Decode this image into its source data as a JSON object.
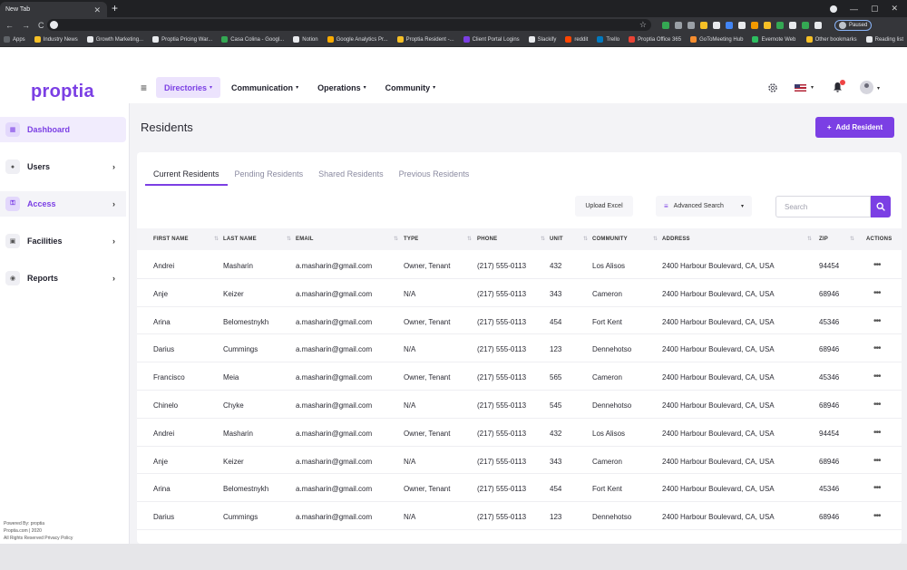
{
  "browser": {
    "tab_title": "New Tab",
    "tab_close": "✕",
    "new_tab": "+",
    "nav": [
      "←",
      "→",
      "C"
    ],
    "star": "☆",
    "paused_label": "Paused",
    "bookmarks": [
      {
        "label": "Apps",
        "color": "#5f6368"
      },
      {
        "label": "Industry News",
        "color": "#f6c026"
      },
      {
        "label": "Growth Marketing...",
        "color": "#e8eaed"
      },
      {
        "label": "Proptia Pricing War...",
        "color": "#e8eaed"
      },
      {
        "label": "Casa Colina - Googl...",
        "color": "#34a853"
      },
      {
        "label": "Notion",
        "color": "#e8eaed"
      },
      {
        "label": "Google Analytics Pr...",
        "color": "#f9ab00"
      },
      {
        "label": "Proptia Resident -...",
        "color": "#f6c026"
      },
      {
        "label": "Client Portal Logins",
        "color": "#7b3fe4"
      },
      {
        "label": "Slackify",
        "color": "#e8eaed"
      },
      {
        "label": "reddit",
        "color": "#ff4500"
      },
      {
        "label": "Trello",
        "color": "#0079bf"
      },
      {
        "label": "Proptia Office 365",
        "color": "#ea4335"
      },
      {
        "label": "GoToMeeting Hub",
        "color": "#f68d2e"
      },
      {
        "label": "Evernote Web",
        "color": "#2dbe60"
      }
    ],
    "bookmarks_right": [
      {
        "label": "Other bookmarks",
        "color": "#f6c026"
      },
      {
        "label": "Reading list",
        "color": "#e8eaed"
      }
    ]
  },
  "brand": {
    "logo": "proptia",
    "accent": "#7b3fe4"
  },
  "topnav": {
    "menu_icon": "≡",
    "items": [
      {
        "label": "Directories",
        "active": true
      },
      {
        "label": "Communication",
        "active": false
      },
      {
        "label": "Operations",
        "active": false
      },
      {
        "label": "Community",
        "active": false
      }
    ],
    "caret": "▾"
  },
  "sidebar": {
    "items": [
      {
        "label": "Dashboard",
        "icon": "grid-icon",
        "glyph": "▦",
        "chevron": ""
      },
      {
        "label": "Users",
        "icon": "users-icon",
        "glyph": "●",
        "chevron": "›"
      },
      {
        "label": "Access",
        "icon": "key-icon",
        "glyph": "⚿",
        "chevron": "›"
      },
      {
        "label": "Facilities",
        "icon": "building-icon",
        "glyph": "▣",
        "chevron": "›"
      },
      {
        "label": "Reports",
        "icon": "report-icon",
        "glyph": "◉",
        "chevron": "›"
      }
    ],
    "footer": [
      "Powered By: proptia",
      "Proptia.com | 2020",
      "All Rights Reserved Privacy Policy"
    ]
  },
  "page": {
    "title": "Residents",
    "add_button": "Add Resident",
    "add_icon": "+"
  },
  "tabs": [
    {
      "label": "Current Residents",
      "active": true
    },
    {
      "label": "Pending Residents",
      "active": false
    },
    {
      "label": "Shared Residents",
      "active": false
    },
    {
      "label": "Previous Residents",
      "active": false
    }
  ],
  "toolbar": {
    "upload_label": "Upload Excel",
    "advanced_label": "Advanced Search",
    "advanced_icon": "≡",
    "advanced_chev": "▾",
    "search_placeholder": "Search"
  },
  "table": {
    "columns": [
      "FIRST NAME",
      "LAST NAME",
      "EMAIL",
      "TYPE",
      "PHONE",
      "UNIT",
      "COMMUNITY",
      "ADDRESS",
      "ZIP",
      "ACTIONS"
    ],
    "sort_glyph": "⇅",
    "row_action": "•••",
    "rows": [
      [
        "Andrei",
        "Masharin",
        "a.masharin@gmail.com",
        "Owner, Tenant",
        "(217) 555-0113",
        "432",
        "Los Alisos",
        "2400 Harbour Boulevard, CA, USA",
        "94454"
      ],
      [
        "Anje",
        "Keizer",
        "a.masharin@gmail.com",
        "N/A",
        "(217) 555-0113",
        "343",
        "Cameron",
        "2400 Harbour Boulevard, CA, USA",
        "68946"
      ],
      [
        "Arina",
        "Belomestnykh",
        "a.masharin@gmail.com",
        "Owner, Tenant",
        "(217) 555-0113",
        "454",
        "Fort Kent",
        "2400 Harbour Boulevard, CA, USA",
        "45346"
      ],
      [
        "Darius",
        "Cummings",
        "a.masharin@gmail.com",
        "N/A",
        "(217) 555-0113",
        "123",
        "Dennehotso",
        "2400 Harbour Boulevard, CA, USA",
        "68946"
      ],
      [
        "Francisco",
        "Meia",
        "a.masharin@gmail.com",
        "Owner, Tenant",
        "(217) 555-0113",
        "565",
        "Cameron",
        "2400 Harbour Boulevard, CA, USA",
        "45346"
      ],
      [
        "Chinelo",
        "Chyke",
        "a.masharin@gmail.com",
        "N/A",
        "(217) 555-0113",
        "545",
        "Dennehotso",
        "2400 Harbour Boulevard, CA, USA",
        "68946"
      ],
      [
        "Andrei",
        "Masharin",
        "a.masharin@gmail.com",
        "Owner, Tenant",
        "(217) 555-0113",
        "432",
        "Los Alisos",
        "2400 Harbour Boulevard, CA, USA",
        "94454"
      ],
      [
        "Anje",
        "Keizer",
        "a.masharin@gmail.com",
        "N/A",
        "(217) 555-0113",
        "343",
        "Cameron",
        "2400 Harbour Boulevard, CA, USA",
        "68946"
      ],
      [
        "Arina",
        "Belomestnykh",
        "a.masharin@gmail.com",
        "Owner, Tenant",
        "(217) 555-0113",
        "454",
        "Fort Kent",
        "2400 Harbour Boulevard, CA, USA",
        "45346"
      ],
      [
        "Darius",
        "Cummings",
        "a.masharin@gmail.com",
        "N/A",
        "(217) 555-0113",
        "123",
        "Dennehotso",
        "2400 Harbour Boulevard, CA, USA",
        "68946"
      ]
    ]
  }
}
